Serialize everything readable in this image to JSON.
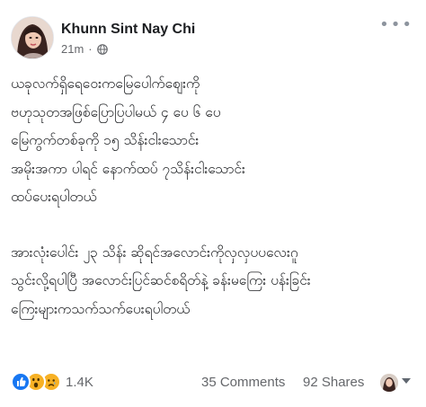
{
  "post": {
    "author": "Khunn Sint Nay Chi",
    "time": "21m",
    "privacy_icon": "globe-icon",
    "lines": [
      "ယခုလက်ရှိရေ၀ေးကမြေပေါက်စျေးကို",
      "ဗဟုသုတအဖြစ်ပြောပြပါမယ် ၄ ပေ ၆ ပေ",
      "မြေကွက်တစ်ခုကို ၁၅ သိန်းငါးသောင်း",
      "အမိုးအကာ ပါရင် နောက်ထပ် ၇သိန်းငါးသောင်း",
      "ထပ်ပေးရပါတယ်",
      "",
      "အားလုံးပေါင်း ၂၃ သိန်း ဆိုရင်အလောင်းကိုလှလှပပလေးဂူ",
      "သွင်းလို့ရပါပြီ  အလောင်းပြင်ဆင်စရိတ်နဲ့ ခန်းမကြေး ပန်းခြင်း",
      "ကြေးများကသက်သက်ပေးရပါတယ်"
    ]
  },
  "footer": {
    "reaction_icons": [
      "like-icon",
      "wow-icon",
      "sad-icon"
    ],
    "reaction_count": "1.4K",
    "comments": "35 Comments",
    "shares": "92 Shares"
  }
}
